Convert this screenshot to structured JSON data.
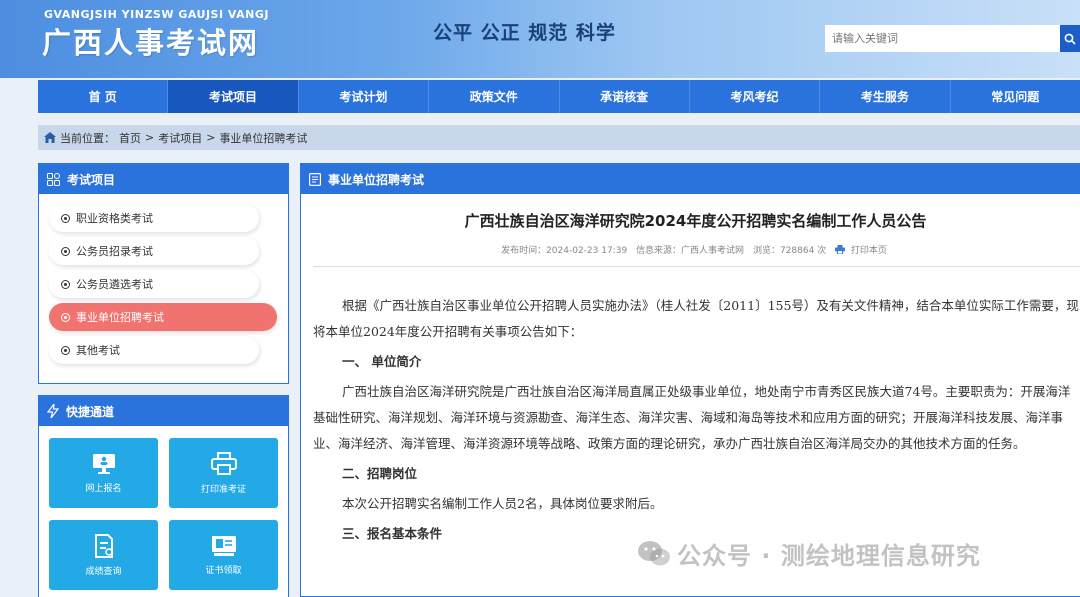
{
  "header": {
    "logo_en": "GVANGJSIH YINZSW GAUJSI VANGJ",
    "logo_cn": "广西人事考试网",
    "slogan": "公平 公正 规范 科学",
    "search_placeholder": "请输入关键词"
  },
  "nav": {
    "items": [
      {
        "label": "首 页"
      },
      {
        "label": "考试项目",
        "active": true
      },
      {
        "label": "考试计划"
      },
      {
        "label": "政策文件"
      },
      {
        "label": "承诺核查"
      },
      {
        "label": "考风考纪"
      },
      {
        "label": "考生服务"
      },
      {
        "label": "常见问题"
      }
    ]
  },
  "breadcrumb": {
    "prefix": "当前位置：",
    "items": [
      "首页",
      ">",
      "考试项目",
      ">",
      "事业单位招聘考试"
    ]
  },
  "sidebar": {
    "projects_title": "考试项目",
    "menu": [
      {
        "label": "职业资格类考试"
      },
      {
        "label": "公务员招录考试"
      },
      {
        "label": "公务员遴选考试"
      },
      {
        "label": "事业单位招聘考试",
        "active": true
      },
      {
        "label": "其他考试"
      }
    ],
    "quick_title": "快捷通道",
    "quick": [
      {
        "label": "网上报名",
        "icon": "monitor-icon"
      },
      {
        "label": "打印准考证",
        "icon": "printer-icon"
      },
      {
        "label": "成绩查询",
        "icon": "document-icon"
      },
      {
        "label": "证书领取",
        "icon": "certificate-icon"
      }
    ]
  },
  "main": {
    "section_title": "事业单位招聘考试",
    "article_title": "广西壮族自治区海洋研究院2024年度公开招聘实名编制工作人员公告",
    "meta": {
      "publish_time": "发布时间：2024-02-23 17:39",
      "source": "信息来源：广西人事考试网",
      "views": "浏览：728864 次",
      "print": "打印本页"
    },
    "paragraphs": {
      "intro": "根据《广西壮族自治区事业单位公开招聘人员实施办法》（桂人社发〔2011〕155号）及有关文件精神，结合本单位实际工作需要，现将本单位2024年度公开招聘有关事项公告如下：",
      "h1": "一、  单位简介",
      "p1": "广西壮族自治区海洋研究院是广西壮族自治区海洋局直属正处级事业单位，地处南宁市青秀区民族大道74号。主要职责为：开展海洋基础性研究、海洋规划、海洋环境与资源勘查、海洋生态、海洋灾害、海域和海岛等技术和应用方面的研究；开展海洋科技发展、海洋事业、海洋经济、海洋管理、海洋资源环境等战略、政策方面的理论研究，承办广西壮族自治区海洋局交办的其他技术方面的任务。",
      "h2": "二、招聘岗位",
      "p2": "本次公开招聘实名编制工作人员2名，具体岗位要求附后。",
      "h3": "三、报名基本条件"
    }
  },
  "watermark": "公众号 · 测绘地理信息研究"
}
